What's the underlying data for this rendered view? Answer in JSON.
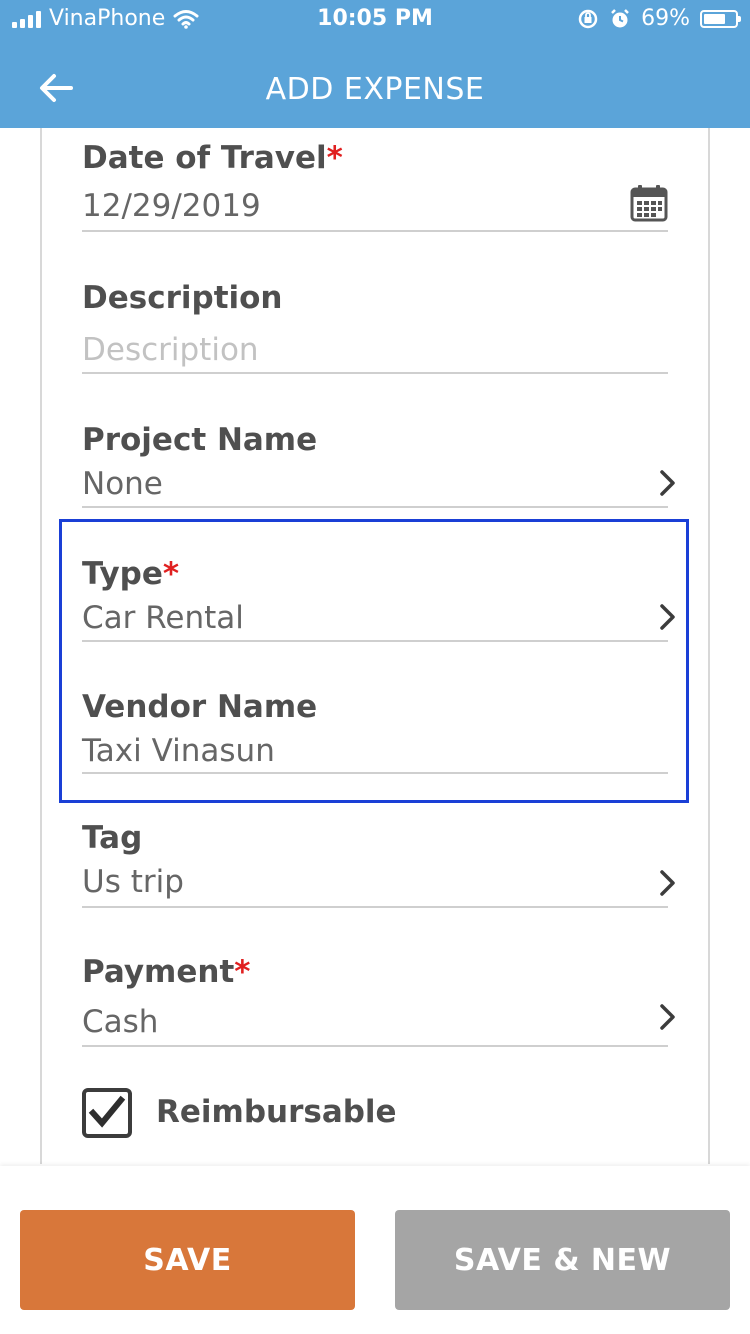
{
  "status_bar": {
    "carrier": "VinaPhone",
    "time": "10:05 PM",
    "battery": "69%",
    "battery_level": 0.69
  },
  "header": {
    "title": "ADD EXPENSE",
    "back_icon": "arrow-left-icon"
  },
  "form": {
    "date": {
      "label": "Date of Travel",
      "required_mark": "*",
      "value": "12/29/2019",
      "icon": "calendar-icon"
    },
    "description": {
      "label": "Description",
      "placeholder": "Description",
      "value": ""
    },
    "project": {
      "label": "Project Name",
      "value": "None",
      "icon": "chevron-right-icon"
    },
    "type": {
      "label": "Type",
      "required_mark": "*",
      "value": "Car Rental",
      "icon": "chevron-right-icon"
    },
    "vendor": {
      "label": "Vendor Name",
      "value": "Taxi Vinasun"
    },
    "tag": {
      "label": "Tag",
      "value": "Us trip",
      "icon": "chevron-right-icon"
    },
    "payment": {
      "label": "Payment",
      "required_mark": "*",
      "value": "Cash",
      "icon": "chevron-right-icon"
    },
    "reimbursable": {
      "label": "Reimbursable",
      "checked": true
    }
  },
  "buttons": {
    "save": "SAVE",
    "save_new": "SAVE & NEW"
  },
  "colors": {
    "header": "#5ba4d9",
    "save": "#d8773a",
    "save_new": "#a5a5a5",
    "required": "#e02020",
    "highlight": "#1a3fd6"
  }
}
